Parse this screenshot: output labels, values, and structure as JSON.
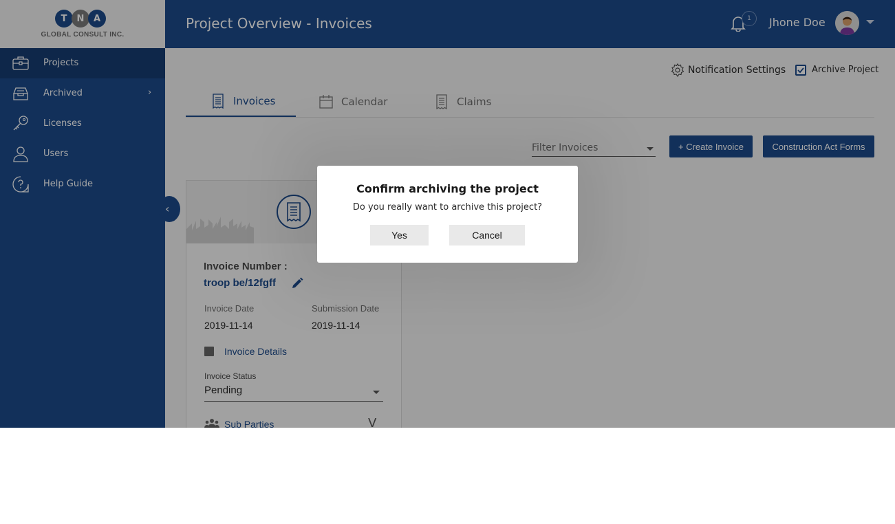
{
  "colors": {
    "primary": "#1c4a8a",
    "active_nav": "#163d72",
    "logo_t": "#1c4a8a",
    "logo_n": "#7a7a7a",
    "logo_a": "#1c4a8a"
  },
  "logo": {
    "letters": [
      "T",
      "N",
      "A"
    ],
    "text": "GLOBAL CONSULT INC."
  },
  "sidebar": {
    "items": [
      {
        "label": "Projects",
        "icon": "briefcase-icon"
      },
      {
        "label": "Archived",
        "icon": "archive-box-icon"
      },
      {
        "label": "Licenses",
        "icon": "key-icon"
      },
      {
        "label": "Users",
        "icon": "user-icon"
      },
      {
        "label": "Help Guide",
        "icon": "help-icon"
      }
    ],
    "archived_chevron": "›",
    "collapse_glyph": "‹"
  },
  "header": {
    "title": "Project Overview - Invoices",
    "notification_count": "1",
    "user_name": "Jhone Doe"
  },
  "controls": {
    "notification_settings": "Notification Settings",
    "archive_project": "Archive Project",
    "archive_checked": true
  },
  "tabs": [
    {
      "label": "Invoices",
      "active": true
    },
    {
      "label": "Calendar",
      "active": false
    },
    {
      "label": "Claims",
      "active": false
    }
  ],
  "toolbar": {
    "filter_placeholder": "Filter Invoices",
    "create_invoice": "+ Create Invoice",
    "construction_forms": "Construction Act Forms"
  },
  "invoice_card": {
    "number_label": "Invoice Number :",
    "number_value": "troop be/12fgff",
    "invoice_date_label": "Invoice Date",
    "invoice_date": "2019-11-14",
    "submission_date_label": "Submission Date",
    "submission_date": "2019-11-14",
    "details_link": "Invoice Details",
    "status_label": "Invoice Status",
    "status_value": "Pending",
    "sub_parties": "Sub Parties",
    "sub_parties_chevron": "V"
  },
  "dialog": {
    "title": "Confirm archiving the project",
    "message": "Do you really want to archive this project?",
    "yes": "Yes",
    "cancel": "Cancel"
  }
}
